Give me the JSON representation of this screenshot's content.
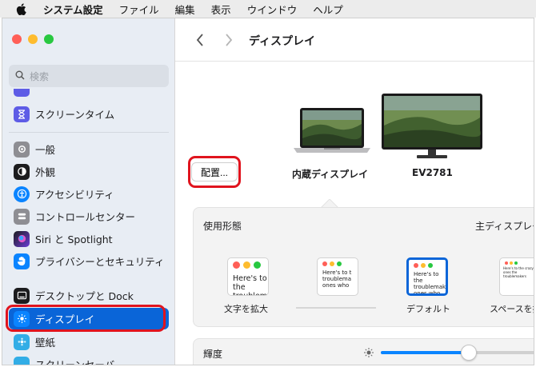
{
  "menubar": {
    "apple_icon": "apple-logo-icon",
    "items": [
      "システム設定",
      "ファイル",
      "編集",
      "表示",
      "ウインドウ",
      "ヘルプ"
    ]
  },
  "window": {
    "traffic_colors": [
      "#ff5f57",
      "#febc2e",
      "#28c840"
    ],
    "search": {
      "placeholder": "検索"
    },
    "sidebar": {
      "items": [
        {
          "label": "スクリーンタイム",
          "icon": "hourglass-icon",
          "color": "#5e5ce6"
        },
        {
          "label": "一般",
          "icon": "gear-icon",
          "color": "#8e8e93"
        },
        {
          "label": "外観",
          "icon": "appearance-icon",
          "color": "#1c1c1e"
        },
        {
          "label": "アクセシビリティ",
          "icon": "accessibility-icon",
          "color": "#0a84ff"
        },
        {
          "label": "コントロールセンター",
          "icon": "control-center-icon",
          "color": "#8e8e93"
        },
        {
          "label": "Siri と Spotlight",
          "icon": "siri-icon",
          "color": "#6b3bd6"
        },
        {
          "label": "プライバシーとセキュリティ",
          "icon": "hand-icon",
          "color": "#0a84ff"
        },
        {
          "label": "デスクトップと Dock",
          "icon": "dock-icon",
          "color": "#1c1c1e"
        },
        {
          "label": "ディスプレイ",
          "icon": "sun-icon",
          "color": "#0a84ff"
        },
        {
          "label": "壁紙",
          "icon": "wallpaper-icon",
          "color": "#32ade6"
        },
        {
          "label": "スクリーンセーバ",
          "icon": "screensaver-icon",
          "color": "#32ade6"
        }
      ],
      "selected": "ディスプレイ"
    },
    "content": {
      "title": "ディスプレイ",
      "arrange_button": "配置...",
      "displays": [
        "内蔵ディスプレイ",
        "EV2781"
      ],
      "usage": {
        "label": "使用形態",
        "main_display_label": "主ディスプレー",
        "options": [
          {
            "caption": "文字を拡大",
            "sample": "Here's to the troublem"
          },
          {
            "caption": "",
            "sample": "Here's to t troublema ones who"
          },
          {
            "caption": "デフォルト",
            "sample": "Here's to the troublemakers ones who see t"
          },
          {
            "caption": "スペースを拡",
            "sample": "Here's to the crazy ones the troublemakers"
          }
        ]
      },
      "brightness": {
        "label": "輝度",
        "level": 0.55
      }
    }
  },
  "colors": {
    "accent": "#0a65d8",
    "highlight": "#e0141e"
  }
}
